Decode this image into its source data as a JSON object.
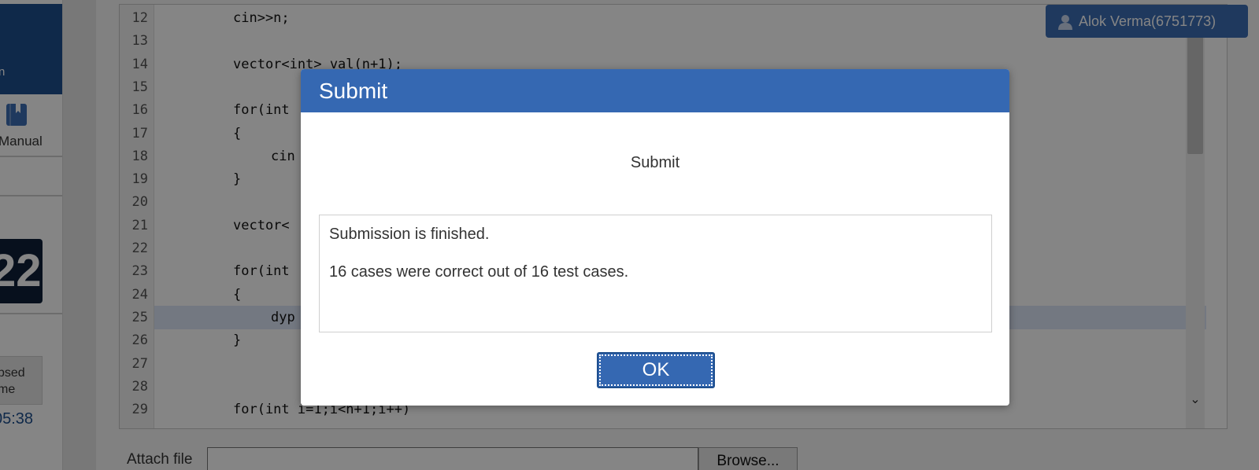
{
  "sidebar": {
    "top_text": "n",
    "manual_label": "Manual",
    "timer_value": "22",
    "elapsed_label_line1": "psed",
    "elapsed_label_line2": "me",
    "elapsed_time": "05:38"
  },
  "user": {
    "name": "Alok Verma(6751773)"
  },
  "editor": {
    "lines": [
      {
        "num": "12",
        "text": "cin>>n;"
      },
      {
        "num": "13",
        "text": ""
      },
      {
        "num": "14",
        "text": "vector<int> val(n+1);"
      },
      {
        "num": "15",
        "text": ""
      },
      {
        "num": "16",
        "text": "for(int"
      },
      {
        "num": "17",
        "text": "{"
      },
      {
        "num": "18",
        "text": "cin"
      },
      {
        "num": "19",
        "text": "}"
      },
      {
        "num": "20",
        "text": ""
      },
      {
        "num": "21",
        "text": "vector<"
      },
      {
        "num": "22",
        "text": ""
      },
      {
        "num": "23",
        "text": "for(int"
      },
      {
        "num": "24",
        "text": "{"
      },
      {
        "num": "25",
        "text": "dyp"
      },
      {
        "num": "26",
        "text": "}"
      },
      {
        "num": "27",
        "text": ""
      },
      {
        "num": "28",
        "text": ""
      },
      {
        "num": "29",
        "text": "for(int i=1;i<n+1;i++)"
      }
    ]
  },
  "attach": {
    "label": "Attach file",
    "browse_label": "Browse..."
  },
  "modal": {
    "title": "Submit",
    "subtitle": "Submit",
    "message_line1": "Submission is finished.",
    "message_line2": "16 cases were correct out of 16 test cases.",
    "ok_label": "OK"
  },
  "colors": {
    "header_blue": "#3568b2",
    "sidebar_blue": "#1e4f8e",
    "timer_bg": "#0e2039"
  }
}
